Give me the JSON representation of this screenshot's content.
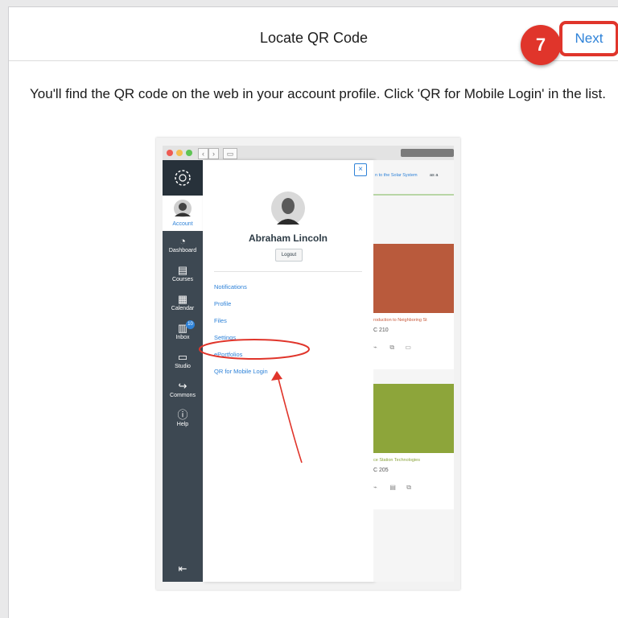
{
  "header": {
    "title": "Locate QR Code",
    "next_label": "Next",
    "step_number": "7"
  },
  "instruction": "You'll find the QR code on the web in your account profile. Click 'QR for Mobile Login' in the list.",
  "embedded_screenshot": {
    "global_nav": {
      "items": [
        "Account",
        "Dashboard",
        "Courses",
        "Calendar",
        "Inbox",
        "Studio",
        "Commons",
        "Help"
      ],
      "inbox_badge": "10",
      "icons": [
        "canvas-logo-icon",
        "avatar-icon",
        "dashboard-icon",
        "courses-icon",
        "calendar-icon",
        "inbox-icon",
        "studio-icon",
        "commons-icon",
        "help-icon",
        "collapse-icon"
      ]
    },
    "tray": {
      "user_name": "Abraham Lincoln",
      "logout_label": "Logout",
      "close_glyph": "×",
      "links": [
        "Notifications",
        "Profile",
        "Files",
        "Settings",
        "ePortfolios",
        "QR for Mobile Login"
      ],
      "highlighted_link": "QR for Mobile Login"
    },
    "courses": {
      "top_link": "n to the Solar System",
      "top_link_suffix": "as a",
      "card1_title": "roduction to Neighboring St",
      "card1_code": "C 210",
      "card2_title": "ce Station Technologies",
      "card2_code": "C 205"
    },
    "colors": {
      "nav_bg": "#3d4852",
      "link": "#2e82d8",
      "annotation": "#e0352b",
      "card1_image": "#b95a3c",
      "card2_image": "#8da53a"
    }
  }
}
